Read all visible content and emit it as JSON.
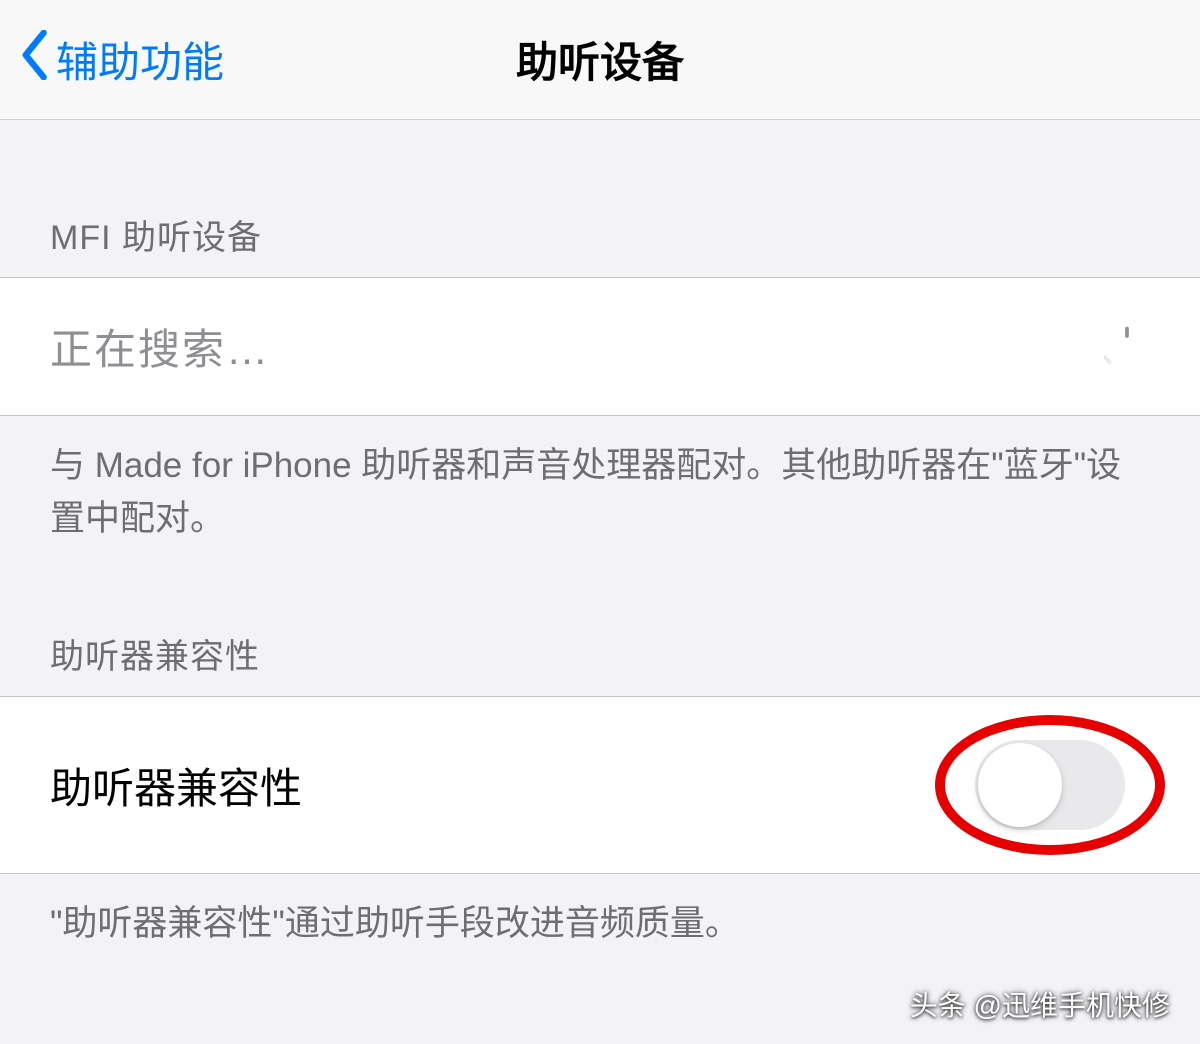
{
  "nav": {
    "back_label": "辅助功能",
    "title": "助听设备"
  },
  "section_mfi": {
    "header": "MFI 助听设备",
    "searching_text": "正在搜索…",
    "footer": "与 Made for iPhone 助听器和声音处理器配对。其他助听器在\"蓝牙\"设置中配对。"
  },
  "section_compat": {
    "header": "助听器兼容性",
    "row_label": "助听器兼容性",
    "toggle_on": false,
    "footer": "\"助听器兼容性\"通过助听手段改进音频质量。"
  },
  "watermark": "头条 @迅维手机快修"
}
